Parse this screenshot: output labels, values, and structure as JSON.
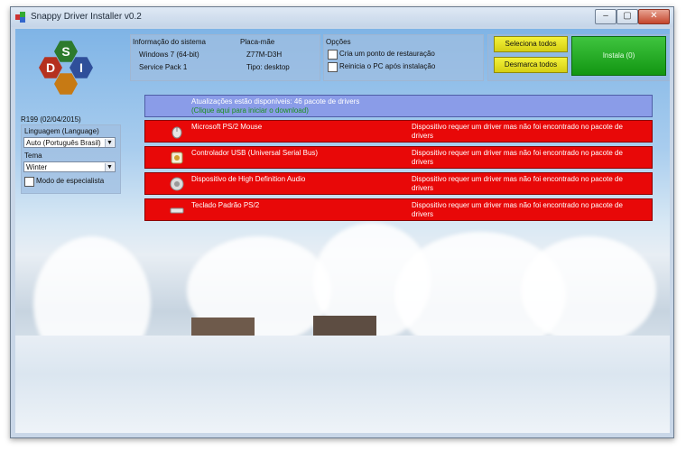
{
  "window": {
    "title": "Snappy Driver Installer v0.2"
  },
  "system": {
    "header_system": "Informação do sistema",
    "header_board": "Placa-mãe",
    "os": "Windows 7 (64-bit)",
    "sp": "Service Pack 1",
    "board": "Z77M-D3H",
    "type": "Tipo: desktop"
  },
  "options": {
    "header": "Opções",
    "restore_point": "Cria um ponto de restauração",
    "reboot": "Reinicia o PC após instalação"
  },
  "buttons": {
    "select_all": "Seleciona todos",
    "deselect_all": "Desmarca todos",
    "install": "Instala (0)"
  },
  "sidebar": {
    "logo_letters": [
      "S",
      "D",
      "I"
    ],
    "revision": "R199 (02/04/2015)",
    "language_label": "Linguagem (Language)",
    "language_value": "Auto (Português Brasil)",
    "theme_label": "Tema",
    "theme_value": "Winter",
    "expert_mode": "Modo de especialista"
  },
  "updates": {
    "text": "Atualizações estão disponíveis: 46 pacote de drivers",
    "subtext": "(Clique aqui para iniciar o download)"
  },
  "devices": [
    {
      "name": "Microsoft PS/2 Mouse",
      "status": "Dispositivo requer um driver mas não foi encontrado no pacote de drivers",
      "icon": "mouse-icon"
    },
    {
      "name": "Controlador USB (Universal Serial Bus)",
      "status": "Dispositivo requer um driver mas não foi encontrado no pacote de drivers",
      "icon": "usb-icon"
    },
    {
      "name": "Dispositivo de High Definition Audio",
      "status": "Dispositivo requer um driver mas não foi encontrado no pacote de drivers",
      "icon": "speaker-icon"
    },
    {
      "name": "Teclado Padrão PS/2",
      "status": "Dispositivo requer um driver mas não foi encontrado no pacote de drivers",
      "icon": "keyboard-icon"
    }
  ],
  "colors": {
    "device_bar": "#e80808",
    "update_bar": "#8a9ce8",
    "select_btn": "#f0ec2a",
    "install_btn": "#1fa81f"
  }
}
